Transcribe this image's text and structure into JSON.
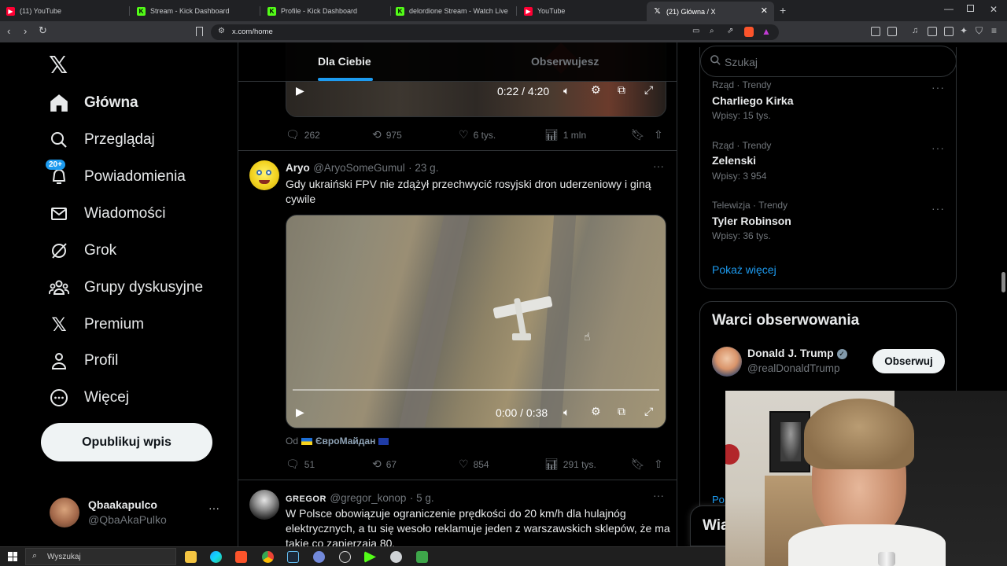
{
  "browser": {
    "tabs": [
      {
        "title": "(11) YouTube",
        "favicon": "youtube-icon"
      },
      {
        "title": "Stream - Kick Dashboard",
        "favicon": "kick-icon"
      },
      {
        "title": "Profile - Kick Dashboard",
        "favicon": "kick-icon"
      },
      {
        "title": "delordione Stream - Watch Live o",
        "favicon": "kick-icon"
      },
      {
        "title": "YouTube",
        "favicon": "youtube-icon"
      },
      {
        "title": "(21) Główna / X",
        "favicon": "x-icon",
        "active": true
      }
    ],
    "url": "x.com/home"
  },
  "sidebar": {
    "items": [
      {
        "label": "Główna",
        "icon": "home-icon"
      },
      {
        "label": "Przeglądaj",
        "icon": "search-icon"
      },
      {
        "label": "Powiadomienia",
        "icon": "bell-icon",
        "badge": "20+"
      },
      {
        "label": "Wiadomości",
        "icon": "mail-icon"
      },
      {
        "label": "Grok",
        "icon": "grok-icon"
      },
      {
        "label": "Grupy dyskusyjne",
        "icon": "communities-icon"
      },
      {
        "label": "Premium",
        "icon": "x-icon"
      },
      {
        "label": "Profil",
        "icon": "profile-icon"
      },
      {
        "label": "Więcej",
        "icon": "more-icon"
      }
    ],
    "publish_label": "Opublikuj wpis",
    "account": {
      "name": "Qbaakapulco",
      "handle": "@QbaAkaPulko",
      "more": "···"
    }
  },
  "feed": {
    "tabs": [
      {
        "label": "Dla Ciebie",
        "active": true
      },
      {
        "label": "Obserwujesz"
      }
    ],
    "post0": {
      "video_time": "0:22 / 4:20",
      "replies": "262",
      "reposts": "975",
      "likes": "6 tys.",
      "views": "1 mln"
    },
    "post1": {
      "name": "Aryo",
      "handle": "@AryoSomeGumul",
      "time": "· 23 g.",
      "text": "Gdy ukraiński FPV nie zdążył przechwycić rosyjski dron uderzeniowy i giną cywile",
      "video_time": "0:00 / 0:38",
      "source_prefix": "Od",
      "source_name": "ЄвроМайдан",
      "replies": "51",
      "reposts": "67",
      "likes": "854",
      "views": "291 tys.",
      "more": "···"
    },
    "post2": {
      "name": "GREGOR",
      "handle": "@gregor_konop",
      "time": "· 5 g.",
      "text": "W Polsce obowiązuje ograniczenie prędkości do 20 km/h dla hulajnóg elektrycznych, a tu się wesoło reklamuje jeden z warszawskich sklepów, że ma takie co zapierzaja 80.",
      "more": "···"
    }
  },
  "right": {
    "search_placeholder": "Szukaj",
    "trends": [
      {
        "meta": "Rząd · Trendy",
        "title": "Charliego Kirka",
        "count": "Wpisy: 15 tys."
      },
      {
        "meta": "Rząd · Trendy",
        "title": "Zelenski",
        "count": "Wpisy: 3 954"
      },
      {
        "meta": "Telewizja · Trendy",
        "title": "Tyler Robinson",
        "count": "Wpisy: 36 tys."
      }
    ],
    "show_more": "Pokaż więcej",
    "follow_title": "Warci obserwowania",
    "follow": {
      "name": "Donald J. Trump",
      "handle": "@realDonaldTrump",
      "button": "Obserwuj"
    },
    "partial_text": "Po",
    "partial_bar": "Wia"
  },
  "taskbar": {
    "search": "Wyszukaj"
  },
  "colors": {
    "accent": "#1d9bf0",
    "bg": "#000000",
    "muted": "#71767b"
  }
}
